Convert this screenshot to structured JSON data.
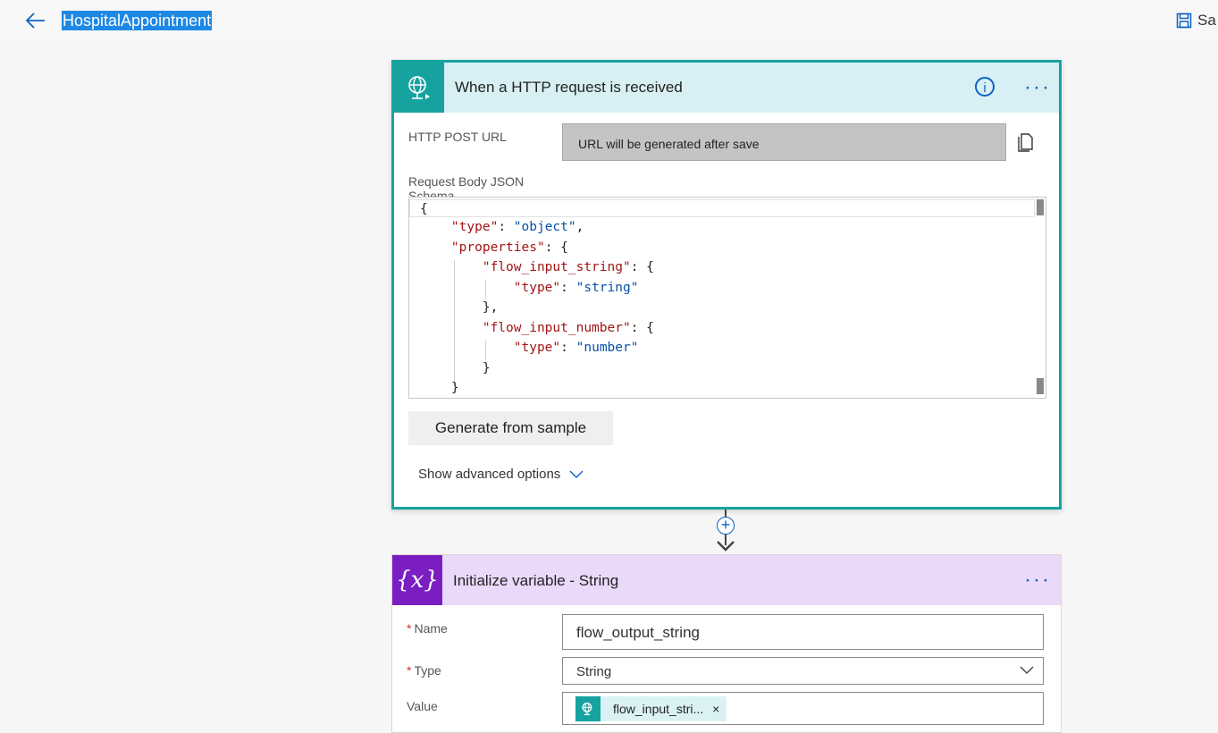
{
  "header": {
    "flow_name": "HospitalAppointment",
    "save_label": "Sa"
  },
  "trigger_card": {
    "title": "When a HTTP request is received",
    "info_glyph": "i",
    "more_glyph": "···",
    "post_url_label": "HTTP POST URL",
    "post_url_value": "URL will be generated after save",
    "schema_label_1": "Request Body JSON",
    "schema_label_2": "Schema",
    "schema_lines": [
      "{",
      "    \"type\": \"object\",",
      "    \"properties\": {",
      "        \"flow_input_string\": {",
      "            \"type\": \"string\"",
      "        },",
      "        \"flow_input_number\": {",
      "            \"type\": \"number\"",
      "        }",
      "    }"
    ],
    "generate_button": "Generate from sample",
    "advanced_toggle": "Show advanced options"
  },
  "connector": {
    "plus_glyph": "+"
  },
  "variable_card": {
    "title": "Initialize variable - String",
    "icon_text": "{x}",
    "more_glyph": "···",
    "required_mark": "*",
    "name_label": "Name",
    "name_value": "flow_output_string",
    "type_label": "Type",
    "type_value": "String",
    "value_label": "Value",
    "value_token": "flow_input_stri...",
    "token_remove": "×"
  },
  "colors": {
    "trigger_accent": "#16a3a0",
    "variable_accent": "#7a1ec2",
    "link_blue": "#0b63c4"
  }
}
